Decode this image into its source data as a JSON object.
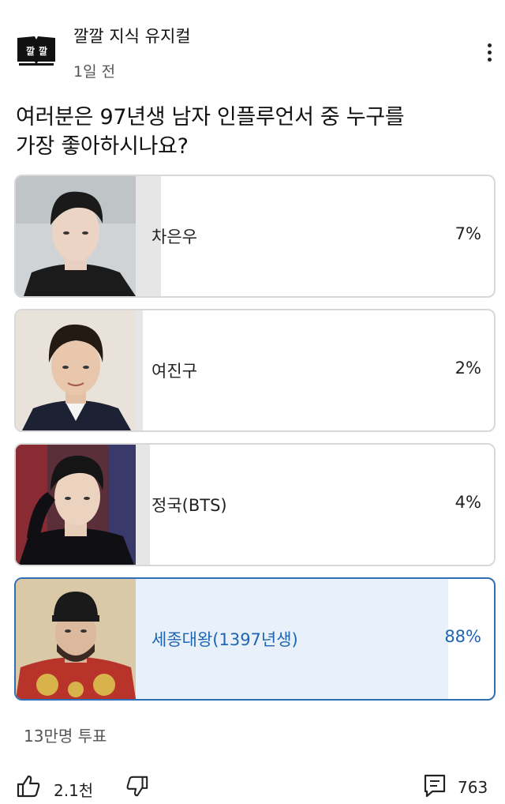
{
  "channel": {
    "name": "깔깔 지식 유지컬",
    "time": "1일 전",
    "avatar_icon": "book-avatar-icon",
    "avatar_text": "깔깔"
  },
  "post": {
    "question_line1": "여러분은 97년생 남자 인플루언서 중 누구를",
    "question_line2": "가장 좋아하시나요?"
  },
  "poll": {
    "options": [
      {
        "label": "차은우",
        "percent": "7%",
        "value": 7,
        "selected": false
      },
      {
        "label": "여진구",
        "percent": "2%",
        "value": 2,
        "selected": false
      },
      {
        "label": "정국(BTS)",
        "percent": "4%",
        "value": 4,
        "selected": false
      },
      {
        "label": "세종대왕(1397년생)",
        "percent": "88%",
        "value": 88,
        "selected": true
      }
    ],
    "total_votes": "13만명 투표"
  },
  "actions": {
    "like_count": "2.1천",
    "comment_count": "763"
  },
  "colors": {
    "selected_accent": "#1f65b3",
    "selected_fill": "#e8f1fa",
    "option_fill": "#e6e6e6"
  }
}
